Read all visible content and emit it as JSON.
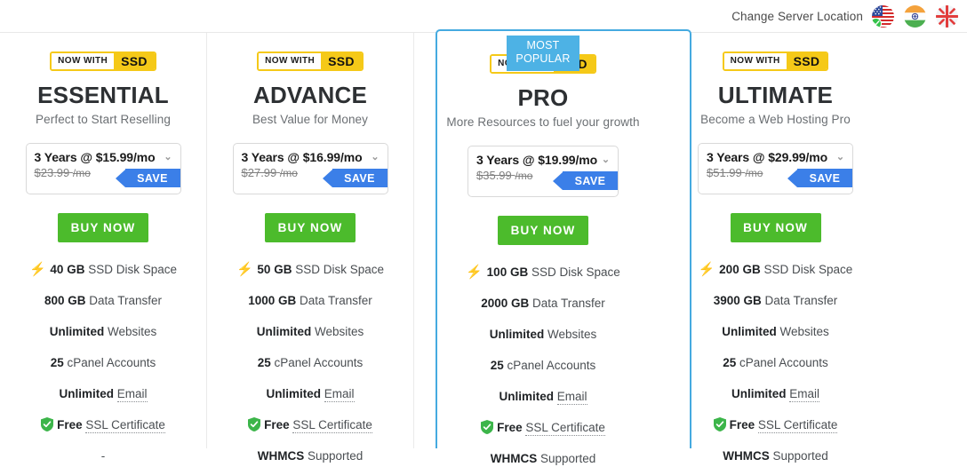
{
  "topbar": {
    "server_location_label": "Change Server Location",
    "flags": [
      {
        "name": "usa-flag",
        "country": "United States",
        "selected": true
      },
      {
        "name": "india-flag",
        "country": "India",
        "selected": false
      },
      {
        "name": "uk-flag",
        "country": "United Kingdom",
        "selected": false
      }
    ]
  },
  "badges": {
    "ssd_prefix": "NOW WITH",
    "ssd_label": "SSD",
    "most_popular": "MOST POPULAR"
  },
  "common": {
    "buy_label": "BUY NOW",
    "save_label": "SAVE",
    "chevron": "⌄",
    "bolt": "⚡",
    "empty_feature": "-"
  },
  "plans": [
    {
      "id": "essential",
      "name": "ESSENTIAL",
      "tagline": "Perfect to Start Reselling",
      "term": "3 Years @ $15.99/mo",
      "old_price": "$23.99",
      "old_unit": "/mo",
      "popular": false,
      "features": [
        {
          "icon": "bolt",
          "strong": "40 GB",
          "rest": "SSD Disk Space",
          "dotted": ""
        },
        {
          "icon": "",
          "strong": "800 GB",
          "rest": "Data Transfer",
          "dotted": ""
        },
        {
          "icon": "",
          "strong": "Unlimited",
          "rest": "Websites",
          "dotted": ""
        },
        {
          "icon": "",
          "strong": "25",
          "rest": "cPanel Accounts",
          "dotted": ""
        },
        {
          "icon": "",
          "strong": "Unlimited",
          "rest": "",
          "dotted": "Email"
        },
        {
          "icon": "shield",
          "strong": "Free",
          "rest": "",
          "dotted": "SSL Certificate"
        },
        {
          "icon": "",
          "strong": "",
          "rest": "-",
          "dotted": ""
        }
      ]
    },
    {
      "id": "advance",
      "name": "ADVANCE",
      "tagline": "Best Value for Money",
      "term": "3 Years @ $16.99/mo",
      "old_price": "$27.99",
      "old_unit": "/mo",
      "popular": false,
      "features": [
        {
          "icon": "bolt",
          "strong": "50 GB",
          "rest": "SSD Disk Space",
          "dotted": ""
        },
        {
          "icon": "",
          "strong": "1000 GB",
          "rest": "Data Transfer",
          "dotted": ""
        },
        {
          "icon": "",
          "strong": "Unlimited",
          "rest": "Websites",
          "dotted": ""
        },
        {
          "icon": "",
          "strong": "25",
          "rest": "cPanel Accounts",
          "dotted": ""
        },
        {
          "icon": "",
          "strong": "Unlimited",
          "rest": "",
          "dotted": "Email"
        },
        {
          "icon": "shield",
          "strong": "Free",
          "rest": "",
          "dotted": "SSL Certificate"
        },
        {
          "icon": "",
          "strong": "WHMCS",
          "rest": "Supported",
          "dotted": ""
        }
      ]
    },
    {
      "id": "pro",
      "name": "PRO",
      "tagline": "More Resources to fuel your growth",
      "term": "3 Years @ $19.99/mo",
      "old_price": "$35.99",
      "old_unit": "/mo",
      "popular": true,
      "features": [
        {
          "icon": "bolt",
          "strong": "100 GB",
          "rest": "SSD Disk Space",
          "dotted": ""
        },
        {
          "icon": "",
          "strong": "2000 GB",
          "rest": "Data Transfer",
          "dotted": ""
        },
        {
          "icon": "",
          "strong": "Unlimited",
          "rest": "Websites",
          "dotted": ""
        },
        {
          "icon": "",
          "strong": "25",
          "rest": "cPanel Accounts",
          "dotted": ""
        },
        {
          "icon": "",
          "strong": "Unlimited",
          "rest": "",
          "dotted": "Email"
        },
        {
          "icon": "shield",
          "strong": "Free",
          "rest": "",
          "dotted": "SSL Certificate"
        },
        {
          "icon": "",
          "strong": "WHMCS",
          "rest": "Supported",
          "dotted": ""
        }
      ]
    },
    {
      "id": "ultimate",
      "name": "ULTIMATE",
      "tagline": "Become a Web Hosting Pro",
      "term": "3 Years @ $29.99/mo",
      "old_price": "$51.99",
      "old_unit": "/mo",
      "popular": false,
      "features": [
        {
          "icon": "bolt",
          "strong": "200 GB",
          "rest": "SSD Disk Space",
          "dotted": ""
        },
        {
          "icon": "",
          "strong": "3900 GB",
          "rest": "Data Transfer",
          "dotted": ""
        },
        {
          "icon": "",
          "strong": "Unlimited",
          "rest": "Websites",
          "dotted": ""
        },
        {
          "icon": "",
          "strong": "25",
          "rest": "cPanel Accounts",
          "dotted": ""
        },
        {
          "icon": "",
          "strong": "Unlimited",
          "rest": "",
          "dotted": "Email"
        },
        {
          "icon": "shield",
          "strong": "Free",
          "rest": "",
          "dotted": "SSL Certificate"
        },
        {
          "icon": "",
          "strong": "WHMCS",
          "rest": "Supported",
          "dotted": ""
        }
      ]
    }
  ],
  "colors": {
    "accent_blue": "#45aae0",
    "save_blue": "#3b7fe8",
    "buy_green": "#4cbb2c",
    "ssd_yellow": "#f5c918",
    "shield_green": "#3cb54a"
  }
}
